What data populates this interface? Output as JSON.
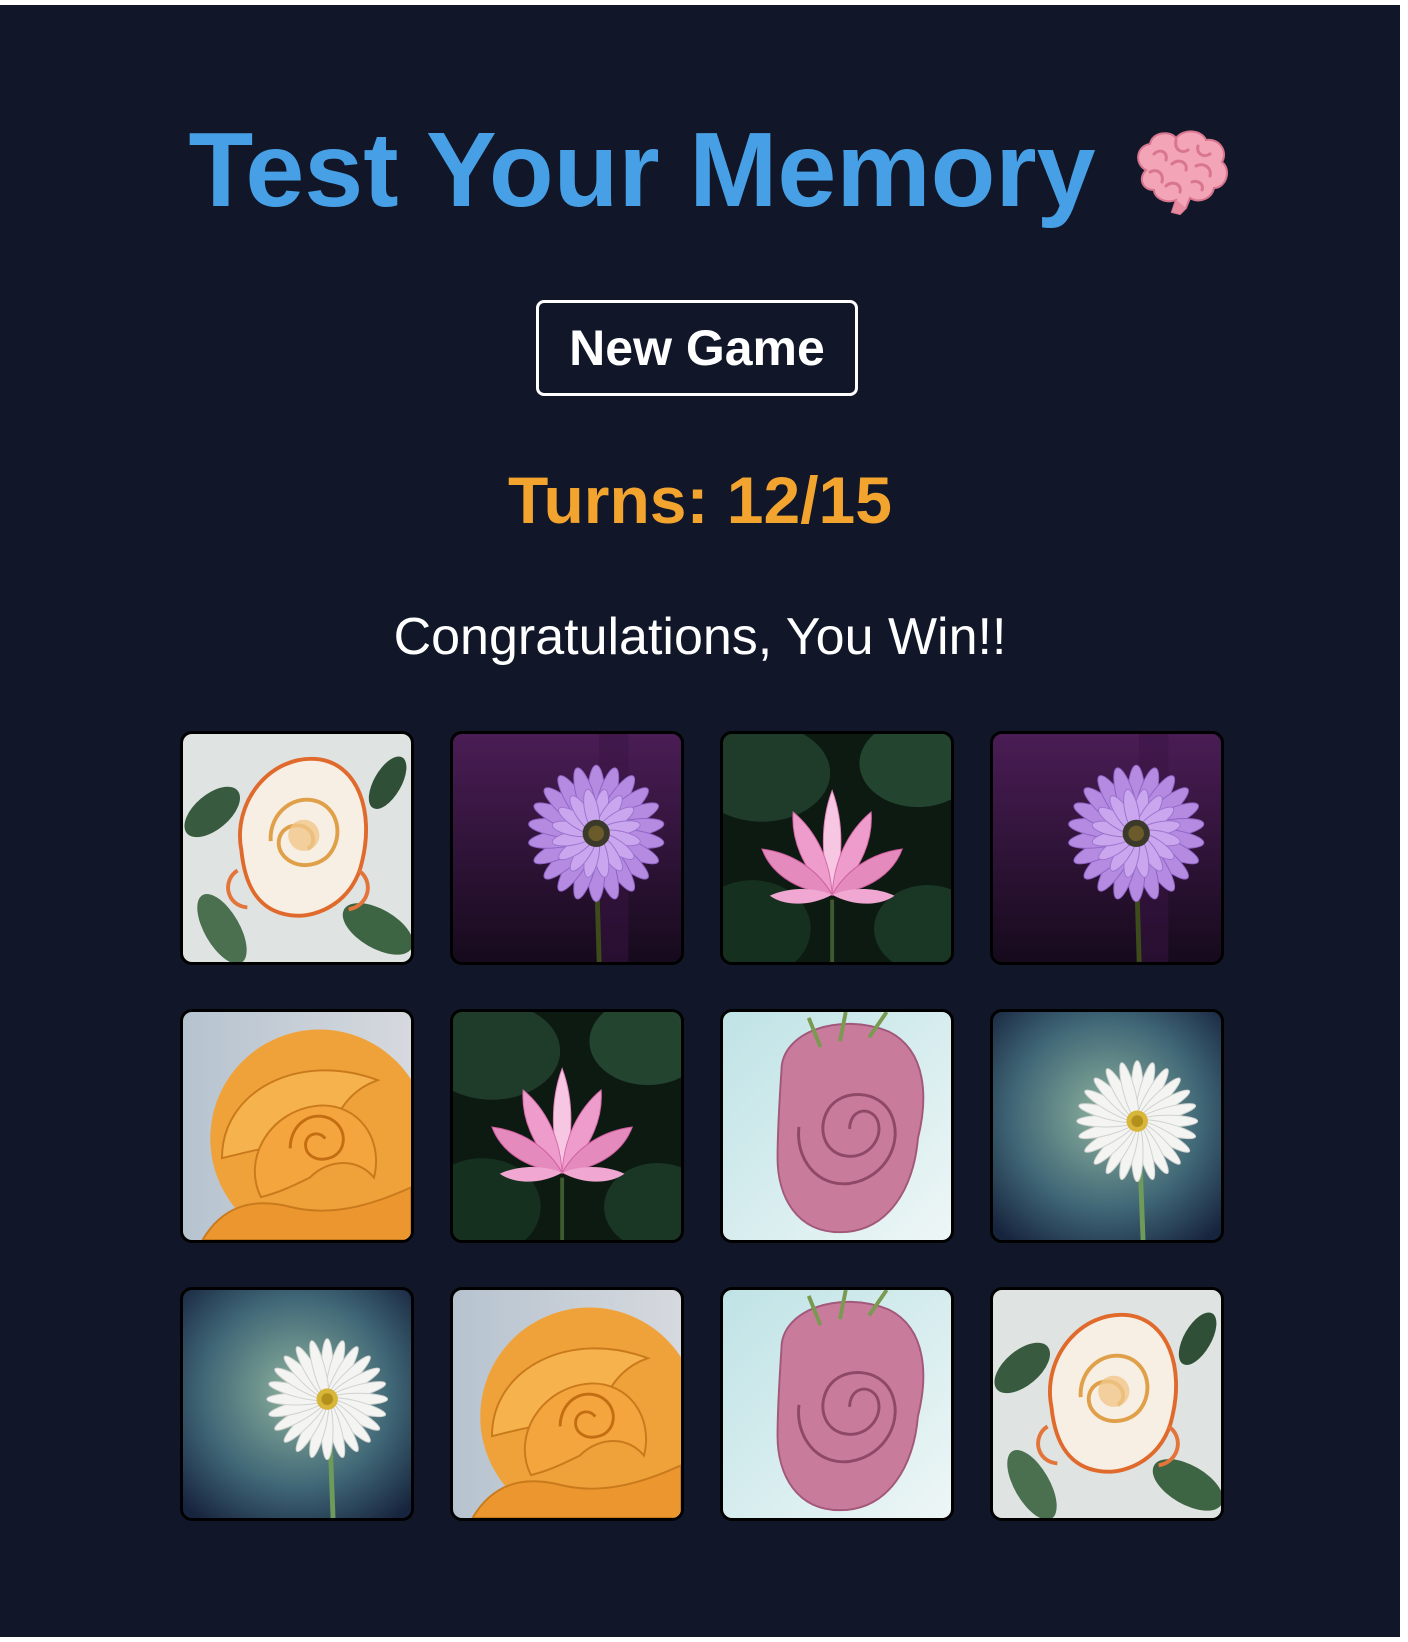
{
  "header": {
    "title": "Test Your Memory",
    "title_icon": "brain-icon"
  },
  "controls": {
    "new_game_label": "New Game"
  },
  "status": {
    "turns_text": "Turns: 12/15",
    "message": "Congratulations, You Win!!"
  },
  "colors": {
    "background": "#111729",
    "title": "#47a0e6",
    "turns": "#f3a42f",
    "text": "#ffffff"
  },
  "cards": [
    {
      "flower": "white-orange-rose",
      "flipped": true
    },
    {
      "flower": "purple-daisy",
      "flipped": true
    },
    {
      "flower": "pink-lotus",
      "flipped": true
    },
    {
      "flower": "purple-daisy",
      "flipped": true
    },
    {
      "flower": "orange-rose",
      "flipped": true
    },
    {
      "flower": "pink-lotus",
      "flipped": true
    },
    {
      "flower": "pink-rose",
      "flipped": true
    },
    {
      "flower": "white-daisy",
      "flipped": true
    },
    {
      "flower": "white-daisy",
      "flipped": true
    },
    {
      "flower": "orange-rose",
      "flipped": true
    },
    {
      "flower": "pink-rose",
      "flipped": true
    },
    {
      "flower": "white-orange-rose",
      "flipped": true
    }
  ]
}
